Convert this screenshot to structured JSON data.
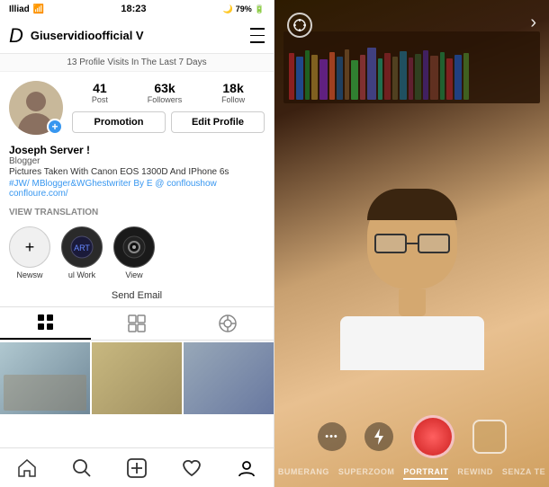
{
  "left": {
    "statusBar": {
      "carrier": "Illiad",
      "wifi": "wifi",
      "time": "18:23",
      "icons": [
        "moon",
        "wifi",
        "battery"
      ],
      "batteryPct": "79%"
    },
    "header": {
      "logo": "D",
      "username": "Giuservidioofficial V",
      "menuIcon": "≡"
    },
    "visitsBanner": "13 Profile Visits In The Last 7 Days",
    "profile": {
      "stats": [
        {
          "number": "41",
          "label": "Post"
        },
        {
          "number": "63k",
          "label": "Followers"
        },
        {
          "number": "18k",
          "label": "Follow"
        }
      ],
      "promotionBtn": "Promotion",
      "editProfileBtn": "Edit Profile",
      "name": "Joseph Server !",
      "role": "Blogger",
      "desc": "Pictures Taken With Canon EOS 1300D And IPhone 6s",
      "tags": "#JW/ MBlogger&WGhestwriter By E @ confloushow",
      "link": "confloure.com/"
    },
    "viewTranslation": "VIEW TRANSLATION",
    "highlights": [
      {
        "label": "Newsw",
        "type": "new",
        "icon": "+"
      },
      {
        "label": "ul Work",
        "type": "circle",
        "icon": "🔵"
      },
      {
        "label": "View",
        "type": "circle",
        "icon": "⚫"
      }
    ],
    "sendEmail": "Send Email",
    "tabs": [
      {
        "id": "grid",
        "icon": "grid",
        "active": true
      },
      {
        "id": "list",
        "icon": "list",
        "active": false
      },
      {
        "id": "tag",
        "icon": "tag",
        "active": false
      }
    ],
    "bottomNav": [
      {
        "id": "home",
        "icon": "home",
        "active": false
      },
      {
        "id": "search",
        "icon": "search",
        "active": false
      },
      {
        "id": "add",
        "icon": "plus",
        "active": false
      },
      {
        "id": "heart",
        "icon": "heart",
        "active": false
      },
      {
        "id": "profile",
        "icon": "person",
        "active": true
      }
    ]
  },
  "right": {
    "topLeft": "⊕",
    "topRight": "›",
    "storyModes": [
      {
        "label": "BUMERANG",
        "active": false
      },
      {
        "label": "SUPERZOOM",
        "active": false
      },
      {
        "label": "PORTRAIT",
        "active": true
      },
      {
        "label": "REWIND",
        "active": false
      },
      {
        "label": "SENZA TE",
        "active": false
      }
    ],
    "controls": {
      "dots": "•••",
      "flash": "⚡",
      "record": "",
      "gallery": ""
    }
  }
}
